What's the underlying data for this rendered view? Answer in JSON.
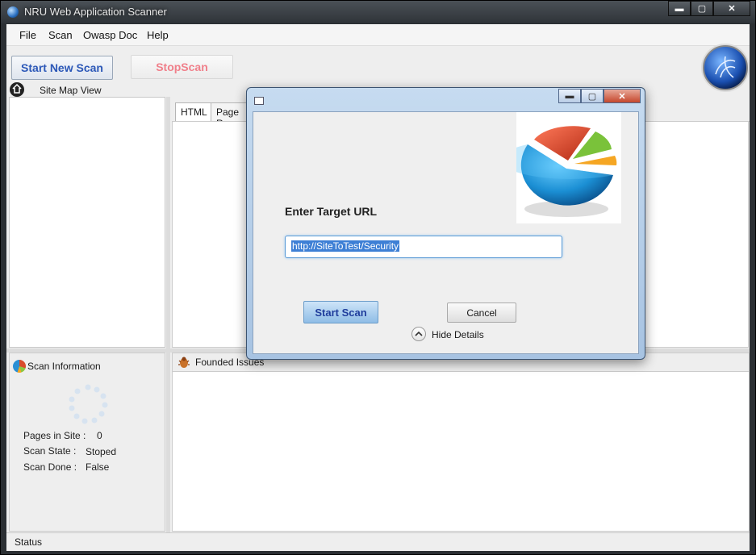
{
  "window": {
    "title": "NRU Web Application Scanner",
    "minimize": "▬",
    "maximize": "▢",
    "close": "✕"
  },
  "menu": [
    "File",
    "Scan",
    "Owasp Doc",
    "Help"
  ],
  "toolbar": {
    "start_label": "Start New Scan",
    "stop_label": "StopScan"
  },
  "sitemap": {
    "title": "Site Map View"
  },
  "tabs": [
    "HTML",
    "Page Re"
  ],
  "scan_info": {
    "title": "Scan Information",
    "rows": [
      {
        "label": "Pages in Site :",
        "value": "0"
      },
      {
        "label": "Scan State :",
        "value": "Stoped"
      },
      {
        "label": "Scan Done :",
        "value": "False"
      }
    ]
  },
  "issues": {
    "title": "Founded Issues"
  },
  "status": {
    "text": "Status"
  },
  "dialog": {
    "target_label": "Enter Target URL",
    "url_value": "http://SiteToTest/Security",
    "start_label": "Start Scan",
    "cancel_label": "Cancel",
    "hide_details_label": "Hide Details"
  },
  "colors": {
    "start_text": "#2c58b8",
    "stop_text": "#f07f8a",
    "selection": "#3d7fd5"
  }
}
